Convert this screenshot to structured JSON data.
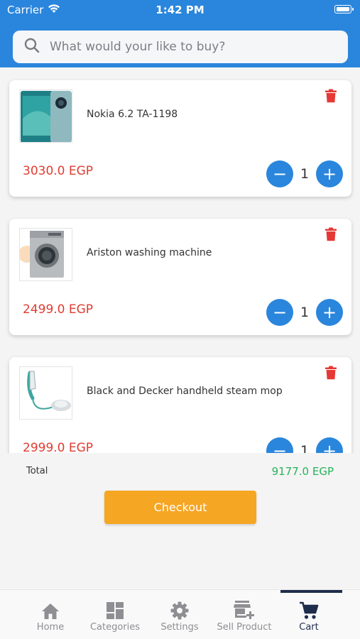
{
  "status_bar": {
    "carrier": "Carrier",
    "time": "1:42 PM"
  },
  "search": {
    "placeholder": "What would your like to buy?"
  },
  "cart": {
    "items": [
      {
        "name": "Nokia 6.2 TA-1198",
        "price": "3030.0 EGP",
        "quantity": "1"
      },
      {
        "name": "Ariston washing machine",
        "price": "2499.0 EGP",
        "quantity": "1"
      },
      {
        "name": "Black and Decker handheld steam mop",
        "price": "2999.0 EGP",
        "quantity": "1"
      }
    ],
    "decrement_symbol": "−",
    "increment_symbol": "+"
  },
  "summary": {
    "total_label": "Total",
    "total_value": "9177.0 EGP",
    "checkout_label": "Checkout"
  },
  "tabs": [
    {
      "label": "Home",
      "icon": "home-icon"
    },
    {
      "label": "Categories",
      "icon": "categories-icon"
    },
    {
      "label": "Settings",
      "icon": "gear-icon"
    },
    {
      "label": "Sell Product",
      "icon": "store-add-icon"
    },
    {
      "label": "Cart",
      "icon": "cart-icon",
      "active": true
    }
  ],
  "colors": {
    "primary": "#2a86dc",
    "price": "#e03c31",
    "total": "#27b35a",
    "checkout": "#f5a623",
    "active_tab": "#1f2d4c"
  }
}
